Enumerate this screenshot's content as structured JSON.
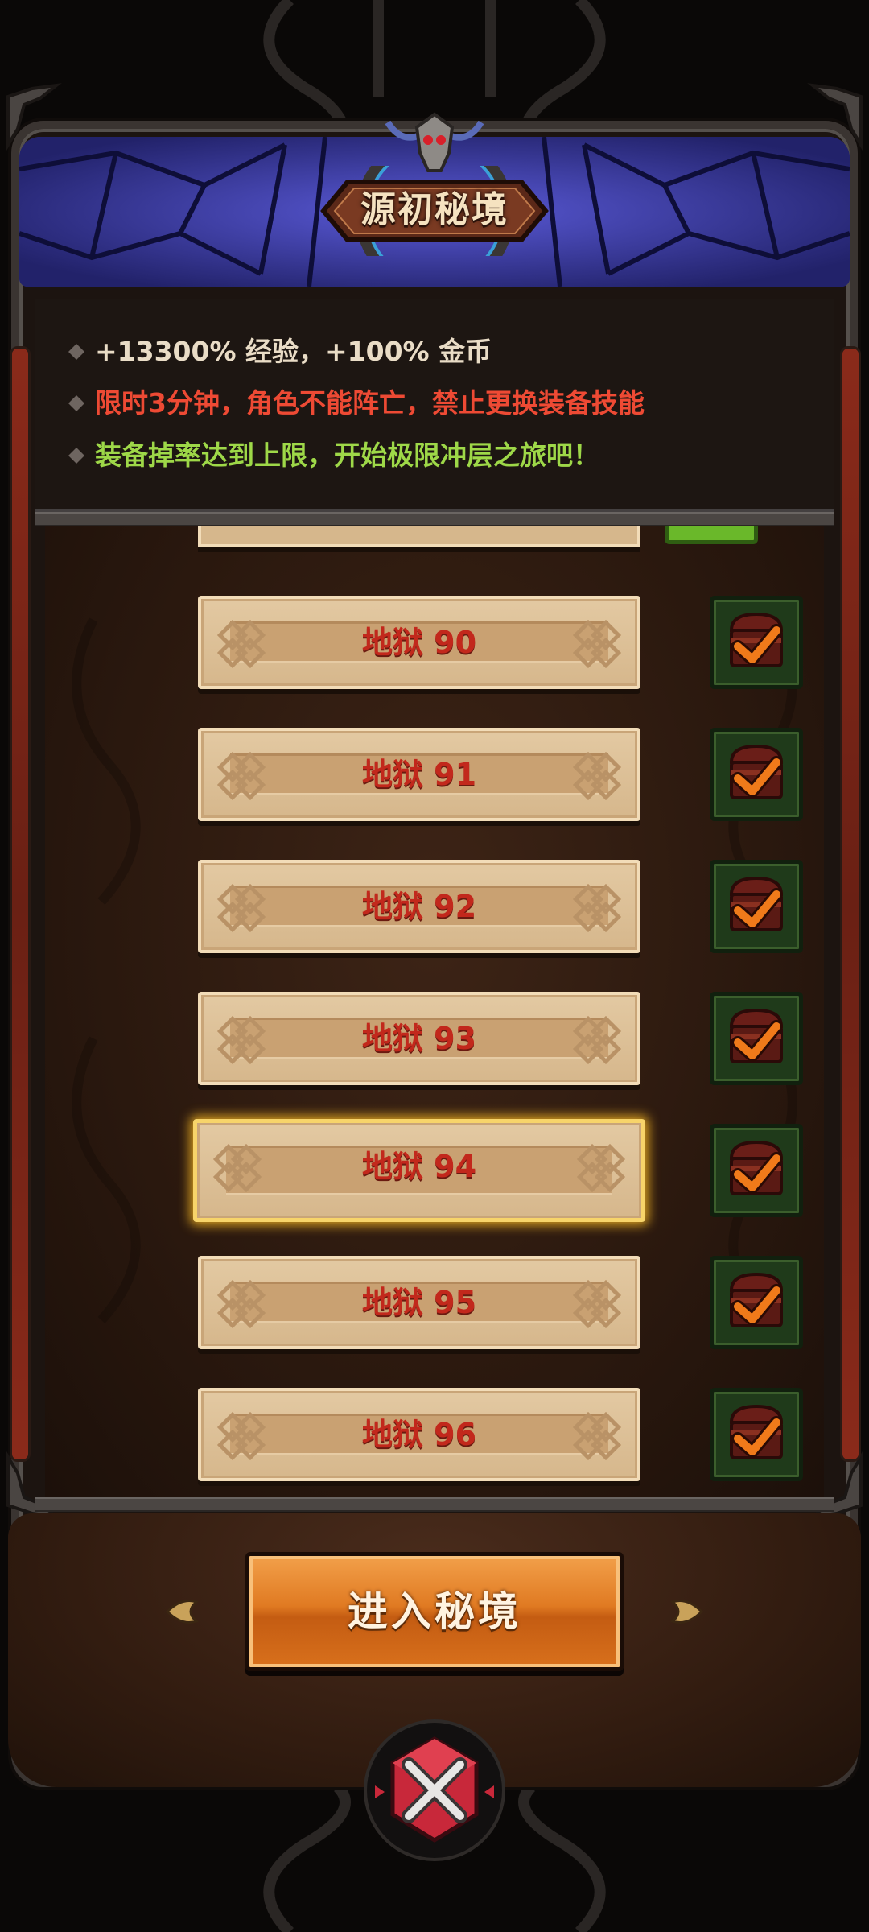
{
  "header": {
    "title": "源初秘境"
  },
  "info": {
    "lines": [
      {
        "text": "+13300% 经验，+100% 金币",
        "color": "#e9dcc6"
      },
      {
        "text": "限时3分钟，角色不能阵亡，禁止更换装备技能",
        "color": "#ee4a34"
      },
      {
        "text": "装备掉率达到上限，开始极限冲层之旅吧！",
        "color": "#9ed848"
      }
    ]
  },
  "levels": [
    {
      "label": "地狱 90",
      "selected": false,
      "reward_icon": "treasure-chest-check-icon"
    },
    {
      "label": "地狱 91",
      "selected": false,
      "reward_icon": "treasure-chest-check-icon"
    },
    {
      "label": "地狱 92",
      "selected": false,
      "reward_icon": "treasure-chest-check-icon"
    },
    {
      "label": "地狱 93",
      "selected": false,
      "reward_icon": "treasure-chest-check-icon"
    },
    {
      "label": "地狱 94",
      "selected": true,
      "reward_icon": "treasure-chest-check-icon"
    },
    {
      "label": "地狱 95",
      "selected": false,
      "reward_icon": "treasure-chest-check-icon"
    },
    {
      "label": "地狱 96",
      "selected": false,
      "reward_icon": "treasure-chest-check-icon"
    }
  ],
  "footer": {
    "enter_label": "进入秘境",
    "close_icon": "close-icon"
  },
  "colors": {
    "level_text": "#c2281c",
    "selected_border": "#f7d46a",
    "button_orange": "#e07a22",
    "reward_green": "#1f3a1a",
    "check_orange": "#f07a1a",
    "banner_blue": "#2a2a7a"
  }
}
